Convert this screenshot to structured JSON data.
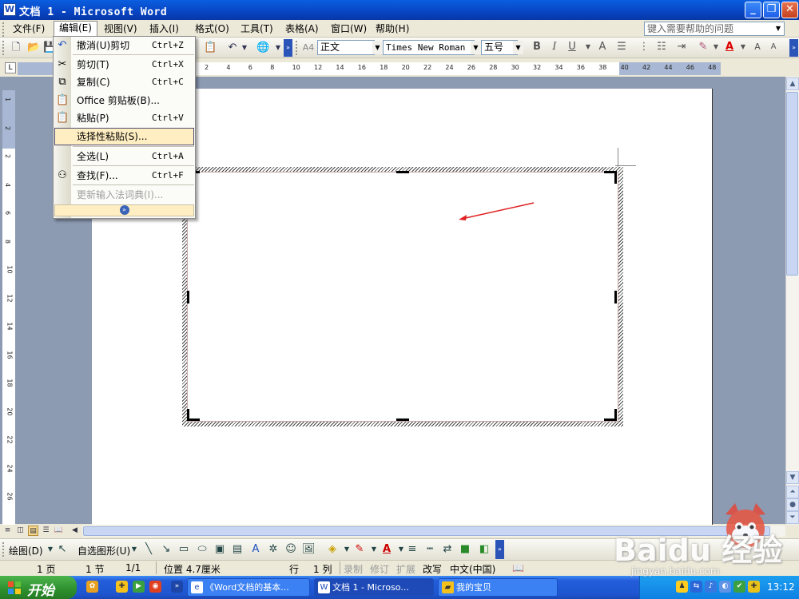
{
  "window": {
    "title": "文档 1 - Microsoft Word",
    "controls": {
      "minimize": "_",
      "maximize": "❐",
      "close": "✕"
    }
  },
  "menubar": {
    "items": [
      {
        "label": "文件(F)"
      },
      {
        "label": "编辑(E)"
      },
      {
        "label": "视图(V)"
      },
      {
        "label": "插入(I)"
      },
      {
        "label": "格式(O)"
      },
      {
        "label": "工具(T)"
      },
      {
        "label": "表格(A)"
      },
      {
        "label": "窗口(W)"
      },
      {
        "label": "帮助(H)"
      }
    ],
    "help_placeholder": "键入需要帮助的问题"
  },
  "edit_menu": {
    "items": [
      {
        "label": "撤消(U)剪切",
        "shortcut": "Ctrl+Z",
        "icon": "undo-icon"
      },
      {
        "label": "剪切(T)",
        "shortcut": "Ctrl+X",
        "icon": "scissors-icon"
      },
      {
        "label": "复制(C)",
        "shortcut": "Ctrl+C",
        "icon": "copy-icon"
      },
      {
        "label": "Office 剪贴板(B)...",
        "shortcut": "",
        "icon": "clipboard-icon"
      },
      {
        "label": "粘贴(P)",
        "shortcut": "Ctrl+V",
        "icon": "paste-icon"
      },
      {
        "label": "选择性粘贴(S)...",
        "shortcut": "",
        "icon": ""
      },
      {
        "label": "全选(L)",
        "shortcut": "Ctrl+A",
        "icon": ""
      },
      {
        "label": "查找(F)...",
        "shortcut": "Ctrl+F",
        "icon": "binoculars-icon"
      },
      {
        "label": "更新输入法词典(I)...",
        "shortcut": "",
        "icon": ""
      }
    ],
    "expand_icon": "double-chevron-down-icon"
  },
  "toolbar": {
    "style": "正文",
    "font": "Times New Roman",
    "size": "五号",
    "bold": "B",
    "italic": "I",
    "underline": "U",
    "font_color": "A"
  },
  "ruler": {
    "ticks": [
      "2",
      "4",
      "6",
      "8",
      "10",
      "12",
      "14",
      "16",
      "18",
      "20",
      "22",
      "24",
      "26",
      "28",
      "30",
      "32",
      "34",
      "36",
      "38",
      "40",
      "42",
      "44",
      "46",
      "48"
    ],
    "vticks": [
      "1",
      "2",
      "2",
      "4",
      "6",
      "8",
      "10",
      "12",
      "14",
      "16",
      "18",
      "20",
      "22",
      "24",
      "26"
    ]
  },
  "drawing_toolbar": {
    "draw": "绘图(D)",
    "autoshapes": "自选图形(U)"
  },
  "statusbar": {
    "page": "1 页",
    "section": "1 节",
    "pages": "1/1",
    "position": "位置 4.7厘米",
    "line": "行",
    "column": "1 列",
    "rec": "录制",
    "trk": "修订",
    "ext": "扩展",
    "ovr": "改写",
    "lang": "中文(中国)"
  },
  "taskbar": {
    "start": "开始",
    "tasks": [
      {
        "label": "《Word文档的基本..."
      },
      {
        "label": "文档 1 - Microso..."
      },
      {
        "label": "我的宝贝"
      }
    ],
    "clock": "13:12"
  },
  "watermark": {
    "text": "Baidu 经验",
    "url": "jingyan.baidu.com"
  },
  "colors": {
    "titlebar": "#0844c2",
    "menu_highlight": "#ffeec2",
    "taskbar": "#245edb",
    "start_button": "#2c8f2c",
    "canvas_arrow": "#e02020"
  }
}
